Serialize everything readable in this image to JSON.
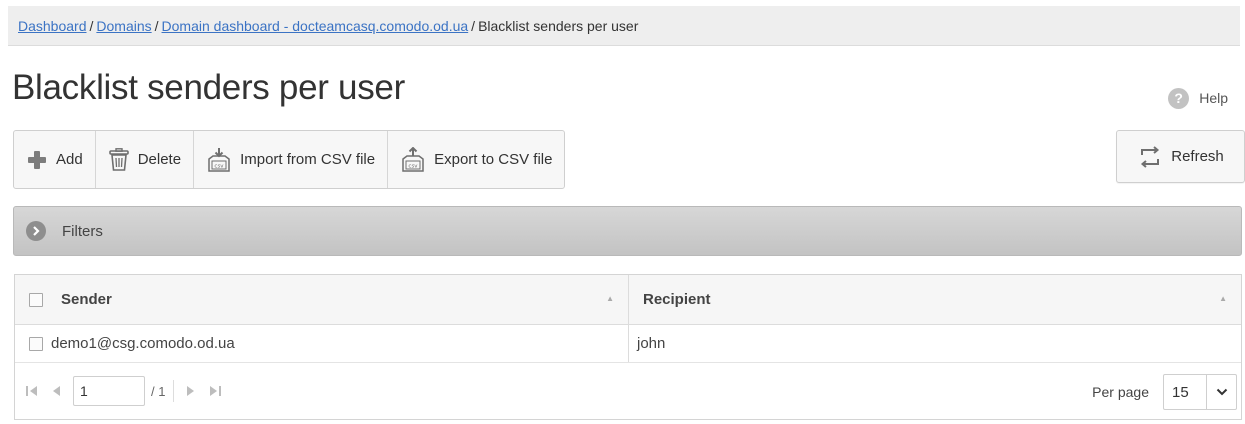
{
  "breadcrumb": {
    "items": [
      {
        "label": "Dashboard"
      },
      {
        "label": "Domains"
      },
      {
        "label": "Domain dashboard - docteamcasq.comodo.od.ua"
      }
    ],
    "separator": "/",
    "current": "Blacklist senders per user"
  },
  "page": {
    "title": "Blacklist senders per user",
    "help_label": "Help",
    "help_glyph": "?"
  },
  "toolbar": {
    "add_label": "Add",
    "delete_label": "Delete",
    "import_label": "Import from CSV file",
    "export_label": "Export to CSV file",
    "refresh_label": "Refresh"
  },
  "filters": {
    "label": "Filters"
  },
  "grid": {
    "columns": [
      {
        "label": "Sender"
      },
      {
        "label": "Recipient"
      }
    ],
    "rows": [
      {
        "sender": "demo1@csg.comodo.od.ua",
        "recipient": "john"
      }
    ]
  },
  "pager": {
    "page": "1",
    "total": "/ 1",
    "per_page_label": "Per page",
    "per_page": "15"
  },
  "colors": {
    "link": "#3b73c4",
    "add_icon": "#7d7d7d",
    "filter_bar": "#c8c8c8"
  },
  "icons": {
    "add": "plus-icon",
    "delete": "trash-icon",
    "import": "import-csv-icon",
    "export": "export-csv-icon",
    "refresh": "refresh-icon",
    "help": "question-icon",
    "filters": "chevron-right-circle-icon"
  }
}
